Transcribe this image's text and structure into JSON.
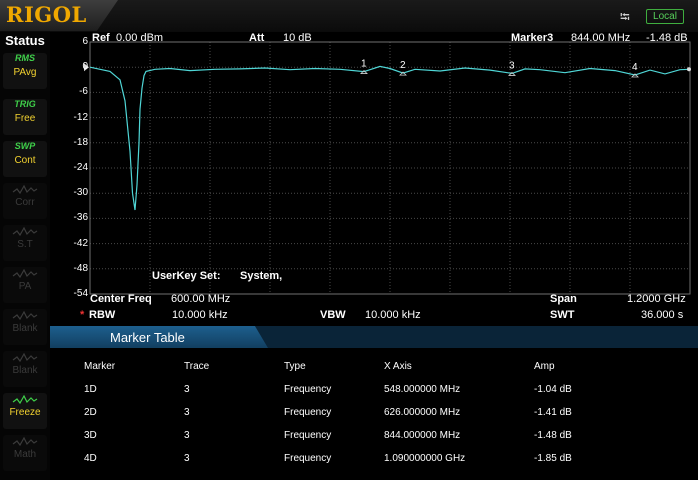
{
  "brand": "RIGOL",
  "top": {
    "local_label": "Local",
    "usb_icon": "usb-icon"
  },
  "sidebar": {
    "title": "Status",
    "items": [
      {
        "top": "RMS",
        "label": "PAvg",
        "state": "on"
      },
      {
        "top": "TRIG",
        "label": "Free",
        "state": "on"
      },
      {
        "top": "SWP",
        "label": "Cont",
        "state": "on"
      },
      {
        "top": "",
        "label": "Corr",
        "state": "off"
      },
      {
        "top": "",
        "label": "S.T",
        "state": "off"
      },
      {
        "top": "",
        "label": "PA",
        "state": "off"
      },
      {
        "top": "",
        "label": "Blank",
        "state": "off"
      },
      {
        "top": "",
        "label": "Blank",
        "state": "off"
      },
      {
        "top": "",
        "label": "Freeze",
        "state": "on"
      },
      {
        "top": "",
        "label": "Math",
        "state": "off"
      }
    ]
  },
  "header": {
    "ref_label": "Ref",
    "ref_value": "0.00 dBm",
    "att_label": "Att",
    "att_value": "10 dB",
    "marker_label": "Marker3",
    "marker_freq": "844.00 MHz",
    "marker_amp": "-1.48 dB"
  },
  "plot": {
    "userkey_label": "UserKey Set:",
    "userkey_value": "System,",
    "y_ticks": [
      "6",
      "0",
      "-6",
      "-12",
      "-18",
      "-24",
      "-30",
      "-36",
      "-42",
      "-48",
      "-54"
    ]
  },
  "footer": {
    "center_label": "Center Freq",
    "center_value": "600.00 MHz",
    "span_label": "Span",
    "span_value": "1.2000 GHz",
    "rbw_star": "*",
    "rbw_label": "RBW",
    "rbw_value": "10.000 kHz",
    "vbw_label": "VBW",
    "vbw_value": "10.000 kHz",
    "swt_label": "SWT",
    "swt_value": "36.000 s"
  },
  "marker_table": {
    "title": "Marker Table",
    "headers": [
      "Marker",
      "Trace",
      "Type",
      "X Axis",
      "Amp"
    ],
    "rows": [
      [
        "1D",
        "3",
        "Frequency",
        "548.000000 MHz",
        "-1.04 dB"
      ],
      [
        "2D",
        "3",
        "Frequency",
        "626.000000 MHz",
        "-1.41 dB"
      ],
      [
        "3D",
        "3",
        "Frequency",
        "844.000000 MHz",
        "-1.48 dB"
      ],
      [
        "4D",
        "3",
        "Frequency",
        "1.090000000 GHz",
        "-1.85 dB"
      ]
    ]
  },
  "chart_data": {
    "type": "line",
    "xlim_mhz": [
      0,
      1200
    ],
    "ylim": [
      -54,
      6
    ],
    "grid": true,
    "trace_color": "#4fd6d6",
    "series": [
      {
        "values_x_mhz": [
          0,
          20,
          40,
          60,
          70,
          80,
          85,
          90,
          94,
          98,
          100,
          104,
          108,
          112,
          130,
          160,
          200,
          250,
          300,
          350,
          400,
          450,
          500,
          548,
          560,
          580,
          600,
          626,
          650,
          700,
          750,
          800,
          844,
          870,
          900,
          950,
          1000,
          1050,
          1090,
          1120,
          1150,
          1180,
          1200
        ],
        "values_db": [
          0,
          -0.5,
          -1,
          -3,
          -8,
          -20,
          -30,
          -34,
          -28,
          -18,
          -10,
          -5,
          -2,
          -1,
          -0.5,
          -0.3,
          -0.8,
          -0.5,
          -0.4,
          -0.2,
          -0.6,
          -0.3,
          -0.5,
          -1.04,
          -0.6,
          0.2,
          -0.3,
          -1.41,
          -0.5,
          -0.9,
          -0.2,
          -0.7,
          -1.48,
          -0.4,
          -0.6,
          -1.3,
          -0.3,
          -0.8,
          -1.85,
          -0.7,
          -1.6,
          -0.6,
          -0.5
        ]
      }
    ],
    "markers": [
      {
        "label": "1",
        "x_mhz": 548,
        "y_db": -1.04
      },
      {
        "label": "2",
        "x_mhz": 626,
        "y_db": -1.41
      },
      {
        "label": "3",
        "x_mhz": 844,
        "y_db": -1.48
      },
      {
        "label": "4",
        "x_mhz": 1090,
        "y_db": -1.85
      }
    ]
  }
}
